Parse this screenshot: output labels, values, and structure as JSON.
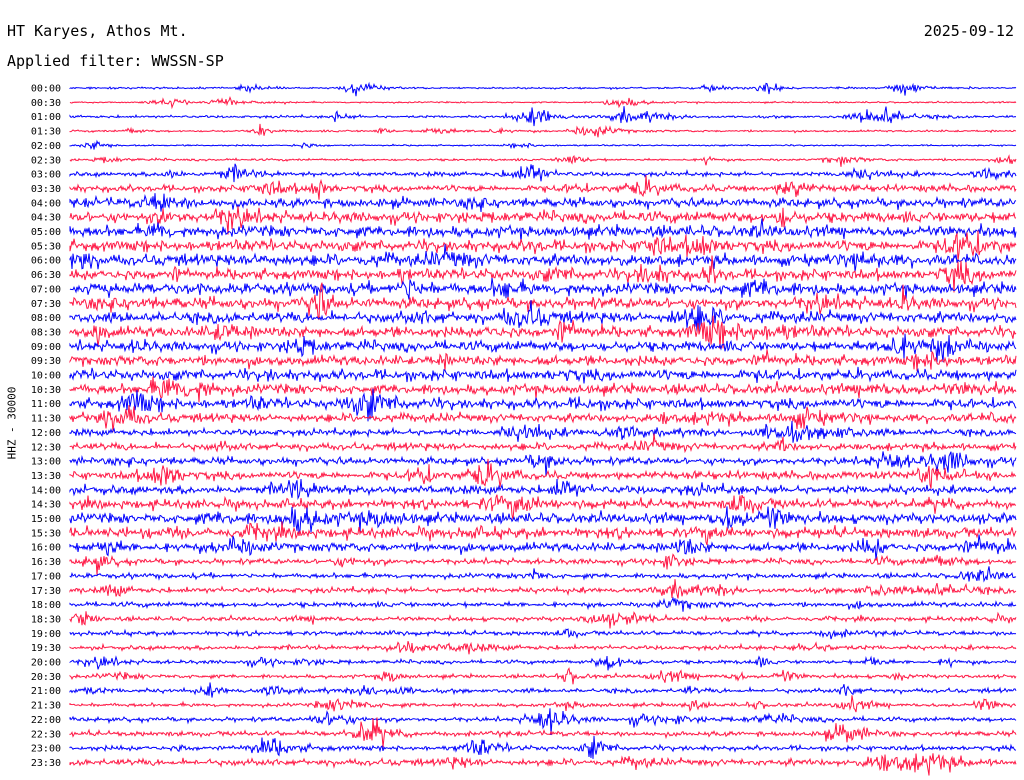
{
  "header": {
    "station": "HT Karyes, Athos Mt.",
    "date": "2025-09-12",
    "filter": "Applied filter: WWSSN-SP"
  },
  "channel_label": "HHZ - 30000",
  "colors": {
    "even_row": "#0000ff",
    "odd_row": "#ff1744",
    "text": "#000000",
    "background": "#ffffff"
  },
  "chart_data": {
    "type": "line",
    "title": "HT Karyes, Athos Mt.",
    "ylabel": "HHZ - 30000",
    "xlabel": "",
    "grid": false,
    "row_labels": [
      "00:00",
      "00:30",
      "01:00",
      "01:30",
      "02:00",
      "02:30",
      "03:00",
      "03:30",
      "04:00",
      "04:30",
      "05:00",
      "05:30",
      "06:00",
      "06:30",
      "07:00",
      "07:30",
      "08:00",
      "08:30",
      "09:00",
      "09:30",
      "10:00",
      "10:30",
      "11:00",
      "11:30",
      "12:00",
      "12:30",
      "13:00",
      "13:30",
      "14:00",
      "14:30",
      "15:00",
      "15:30",
      "16:00",
      "16:30",
      "17:00",
      "17:30",
      "18:00",
      "18:30",
      "19:00",
      "19:30",
      "20:00",
      "20:30",
      "21:00",
      "21:30",
      "22:00",
      "22:30",
      "23:00",
      "23:30"
    ],
    "trace_amplitude_level": [
      0.08,
      0.06,
      0.15,
      0.1,
      0.06,
      0.12,
      0.3,
      0.5,
      0.7,
      0.85,
      0.9,
      0.9,
      0.9,
      0.85,
      0.9,
      0.9,
      0.85,
      0.85,
      0.8,
      0.8,
      0.85,
      0.8,
      0.8,
      0.65,
      0.5,
      0.55,
      0.55,
      0.6,
      0.65,
      0.7,
      0.8,
      0.8,
      0.7,
      0.4,
      0.35,
      0.4,
      0.35,
      0.3,
      0.3,
      0.3,
      0.25,
      0.25,
      0.3,
      0.25,
      0.3,
      0.35,
      0.35,
      0.5
    ]
  }
}
